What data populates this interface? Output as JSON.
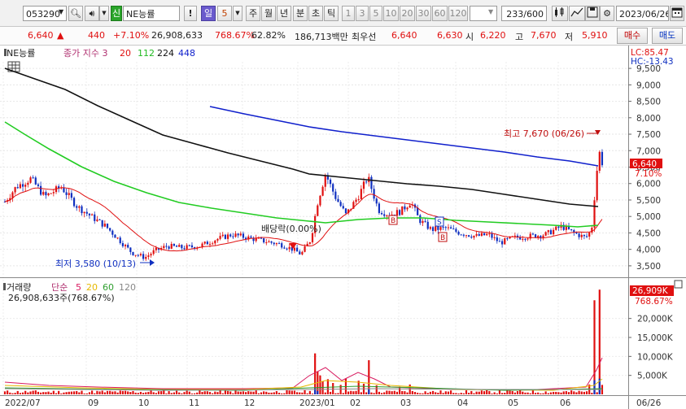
{
  "toolbar": {
    "code": "053290",
    "stock_name": "NE능률",
    "sin_label": "신",
    "warn_label": "!",
    "periods": [
      "일",
      "5",
      "주",
      "월",
      "년",
      "분",
      "초",
      "틱"
    ],
    "numbers": [
      "1",
      "3",
      "5",
      "10",
      "20",
      "30",
      "60",
      "120"
    ],
    "count": "233/600",
    "date": "2023/06/26"
  },
  "quote": {
    "price": "6,640",
    "up_sign": "▲",
    "change": "440",
    "change_pct": "+7.10%",
    "volume": "26,908,633",
    "vol_ratio": "768.67%",
    "ratio2": "62.82%",
    "amount": "186,713백만",
    "best_label": "최우선",
    "best_ask": "6,640",
    "best_bid": "6,630",
    "open_label": "시",
    "open": "6,220",
    "high_label": "고",
    "high": "7,670",
    "low_label": "저",
    "low": "5,910",
    "buy_label": "매수",
    "sell_label": "매도"
  },
  "price_panel": {
    "legend_name": "NE능률",
    "legend_ma": "종가 지수 3",
    "ma_periods": [
      "20",
      "112",
      "224",
      "448"
    ],
    "ma_colors": [
      "#e01010",
      "#22cc22",
      "#111111",
      "#1020cc"
    ],
    "lc_label": "LC:85.47",
    "hc_label": "HC:-13.43",
    "y_ticks": [
      "9,500",
      "9,000",
      "8,500",
      "8,000",
      "7,500",
      "7,000",
      "6,500",
      "6,000",
      "5,500",
      "5,000",
      "4,500",
      "4,000",
      "3,500"
    ],
    "y_min": 3300,
    "y_max": 9700,
    "current_price": "6,640",
    "current_pct": "7.10%",
    "high_annot": "최고 7,670 (06/26)",
    "low_annot": "최저 3,580 (10/13)",
    "dividend_annot": "배당락(0.00%)"
  },
  "volume_panel": {
    "legend_name": "거래량",
    "legend_ma": "단순",
    "ma_periods": [
      "5",
      "20",
      "60",
      "120"
    ],
    "ma_colors": [
      "#d81b60",
      "#e6b800",
      "#2e9e2e",
      "#888888"
    ],
    "total_label": "26,908,633주(768.67%)",
    "current_volume": "26,909K",
    "current_pct": "768.67%",
    "y_ticks": [
      "20,000K",
      "15,000K",
      "10,000K",
      "5,000K"
    ],
    "y_max": 30000
  },
  "x_axis": {
    "labels": [
      "2022/07",
      "09",
      "10",
      "11",
      "12",
      "2023/01",
      "02",
      "03",
      "04",
      "05",
      "06",
      "06/26"
    ]
  },
  "chart_data": {
    "type": "candlestick",
    "period": "daily",
    "price_ylim": [
      3300,
      9700
    ],
    "volume_ylim_k": [
      0,
      30000
    ],
    "last_close": 6640,
    "period_high": 7670,
    "period_low": 3580,
    "last_volume": 26908633
  }
}
